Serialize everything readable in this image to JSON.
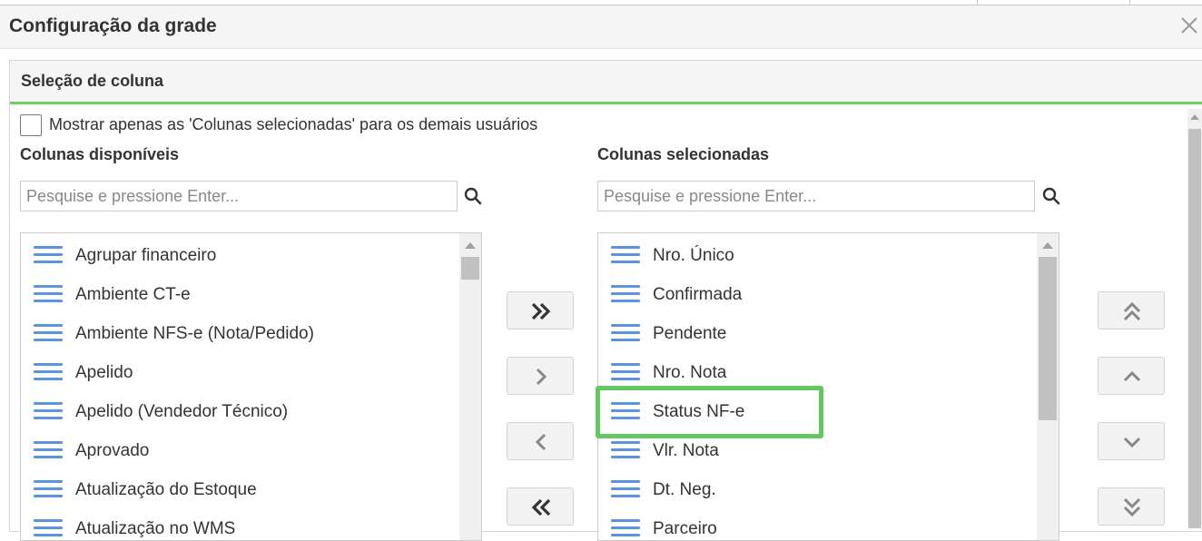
{
  "dialog": {
    "title": "Configuração da grade"
  },
  "section": {
    "title": "Seleção de coluna"
  },
  "option": {
    "checked": false,
    "label": "Mostrar apenas as 'Colunas selecionadas' para os demais usuários"
  },
  "available": {
    "heading": "Colunas disponíveis",
    "search_placeholder": "Pesquise e pressione Enter...",
    "items": [
      "Agrupar financeiro",
      "Ambiente CT-e",
      "Ambiente NFS-e (Nota/Pedido)",
      "Apelido",
      "Apelido (Vendedor Técnico)",
      "Aprovado",
      "Atualização do Estoque",
      "Atualização no WMS"
    ]
  },
  "selected": {
    "heading": "Colunas selecionadas",
    "search_placeholder": "Pesquise e pressione Enter...",
    "highlighted_item": "Status NF-e",
    "items": [
      "Nro. Único",
      "Confirmada",
      "Pendente",
      "Nro. Nota",
      "Status NF-e",
      "Vlr. Nota",
      "Dt. Neg.",
      "Parceiro"
    ]
  },
  "icons": {
    "close": "close-icon",
    "search": "search-icon",
    "drag": "drag-handle-icon",
    "add_all": "double-chevron-right-icon",
    "add": "chevron-right-icon",
    "remove": "chevron-left-icon",
    "remove_all": "double-chevron-left-icon",
    "move_top": "double-chevron-up-icon",
    "move_up": "chevron-up-icon",
    "move_down": "chevron-down-icon",
    "move_bottom": "double-chevron-down-icon"
  },
  "colors": {
    "accent_green": "#6ecf68",
    "drag_icon_blue": "#5b96dc",
    "header_bg": "#f5f5f5"
  }
}
